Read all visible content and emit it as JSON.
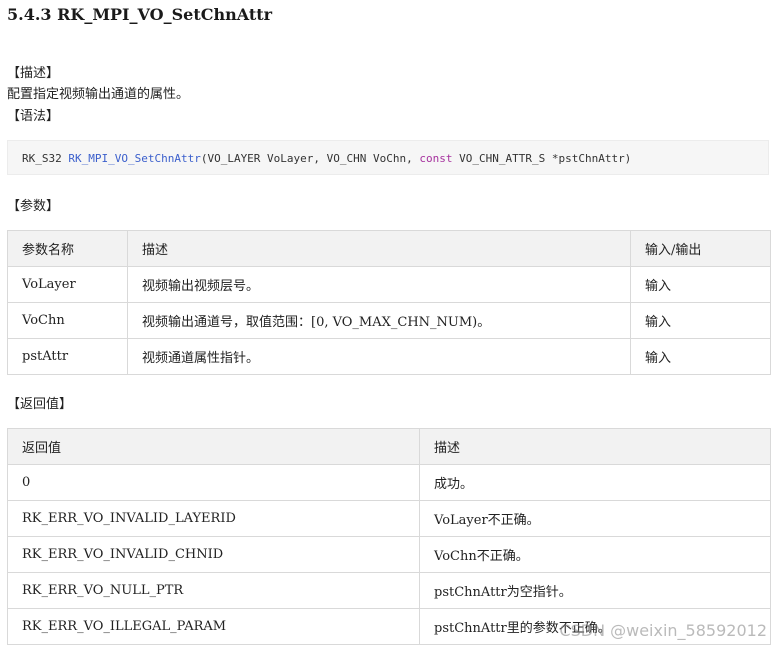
{
  "heading": "5.4.3 RK_MPI_VO_SetChnAttr",
  "description": {
    "label": "【描述】",
    "text": "配置指定视频输出通道的属性。"
  },
  "syntax": {
    "label": "【语法】",
    "return_type": "RK_S32",
    "function_name": "RK_MPI_VO_SetChnAttr",
    "args_part1": "(VO_LAYER VoLayer, VO_CHN VoChn, ",
    "keyword": "const",
    "args_part2": " VO_CHN_ATTR_S *pstChnAttr)"
  },
  "params": {
    "label": "【参数】",
    "headers": [
      "参数名称",
      "描述",
      "输入/输出"
    ],
    "rows": [
      [
        "VoLayer",
        "视频输出视频层号。",
        "输入"
      ],
      [
        "VoChn",
        "视频输出通道号，取值范围：[0, VO_MAX_CHN_NUM)。",
        "输入"
      ],
      [
        "pstAttr",
        "视频通道属性指针。",
        "输入"
      ]
    ]
  },
  "returns": {
    "label": "【返回值】",
    "headers": [
      "返回值",
      "描述"
    ],
    "rows": [
      [
        "0",
        "成功。"
      ],
      [
        "RK_ERR_VO_INVALID_LAYERID",
        "VoLayer不正确。"
      ],
      [
        "RK_ERR_VO_INVALID_CHNID",
        "VoChn不正确。"
      ],
      [
        "RK_ERR_VO_NULL_PTR",
        "pstChnAttr为空指针。"
      ],
      [
        "RK_ERR_VO_ILLEGAL_PARAM",
        "pstChnAttr里的参数不正确。"
      ]
    ]
  },
  "watermark": "CSDN @weixin_58592012"
}
